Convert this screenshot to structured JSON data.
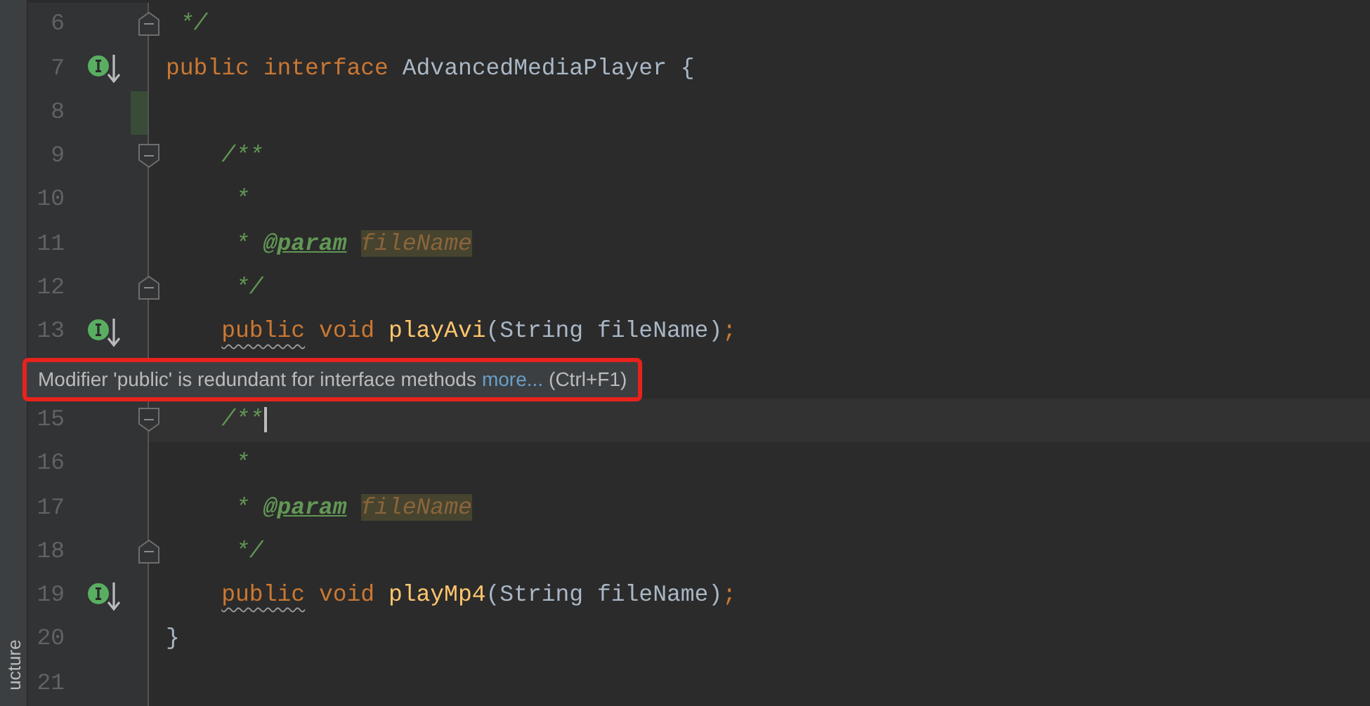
{
  "side_panel": {
    "tab": "ucture"
  },
  "lines_above": [
    {
      "number": "6",
      "implemented": false,
      "fold_start": false,
      "fold_end": true,
      "changed": false,
      "current": false,
      "tokens": [
        {
          "kind": "doc",
          "text": " */"
        }
      ]
    },
    {
      "number": "7",
      "implemented": true,
      "fold_start": false,
      "fold_end": false,
      "changed": false,
      "current": false,
      "tokens": [
        {
          "kind": "keyword",
          "text": "public",
          "warning": false
        },
        {
          "kind": "keyword",
          "text": " interface",
          "warning": false
        },
        {
          "kind": "plain",
          "text": " AdvancedMediaPlayer {"
        }
      ]
    },
    {
      "number": "8",
      "implemented": false,
      "fold_start": false,
      "fold_end": false,
      "changed": true,
      "current": false
    },
    {
      "number": "9",
      "implemented": false,
      "fold_start": true,
      "fold_end": false,
      "changed": false,
      "current": false,
      "tokens": [
        {
          "kind": "doc",
          "text": "    /**"
        }
      ]
    },
    {
      "number": "10",
      "implemented": false,
      "fold_start": false,
      "fold_end": false,
      "changed": false,
      "current": false,
      "tokens": [
        {
          "kind": "doc",
          "text": "     *"
        }
      ]
    },
    {
      "number": "11",
      "implemented": false,
      "fold_start": false,
      "fold_end": false,
      "changed": false,
      "current": false,
      "tokens": [
        {
          "kind": "doc",
          "text": "     *"
        },
        {
          "kind": "doctag",
          "text": " @param"
        },
        {
          "kind": "docparam",
          "text": " fileName"
        }
      ]
    },
    {
      "number": "12",
      "implemented": false,
      "fold_start": false,
      "fold_end": true,
      "changed": false,
      "current": false,
      "tokens": [
        {
          "kind": "doc",
          "text": "     */"
        }
      ]
    },
    {
      "number": "13",
      "implemented": true,
      "fold_start": false,
      "fold_end": false,
      "changed": false,
      "current": false,
      "tokens": [
        {
          "kind": "keyword",
          "text": "    public",
          "warning": true
        },
        {
          "kind": "keyword",
          "text": " void",
          "warning": false
        },
        {
          "kind": "method",
          "text": " playAvi"
        },
        {
          "kind": "plain",
          "text": "(String fileName)"
        },
        {
          "kind": "keyword",
          "text": ";",
          "warning": false
        }
      ]
    }
  ],
  "tooltip": {
    "message": "Modifier 'public' is redundant for interface methods",
    "link": "more...",
    "shortcut": "(Ctrl+F1)"
  },
  "lines_below": [
    {
      "number": "15",
      "implemented": false,
      "fold_start": true,
      "fold_end": false,
      "changed": false,
      "current": true,
      "tokens": [
        {
          "kind": "doc",
          "text": "    /**"
        }
      ]
    },
    {
      "number": "16",
      "implemented": false,
      "fold_start": false,
      "fold_end": false,
      "changed": false,
      "current": false,
      "tokens": [
        {
          "kind": "doc",
          "text": "     *"
        }
      ]
    },
    {
      "number": "17",
      "implemented": false,
      "fold_start": false,
      "fold_end": false,
      "changed": false,
      "current": false,
      "tokens": [
        {
          "kind": "doc",
          "text": "     *"
        },
        {
          "kind": "doctag",
          "text": " @param"
        },
        {
          "kind": "docparam",
          "text": " fileName"
        }
      ]
    },
    {
      "number": "18",
      "implemented": false,
      "fold_start": false,
      "fold_end": true,
      "changed": false,
      "current": false,
      "tokens": [
        {
          "kind": "doc",
          "text": "     */"
        }
      ]
    },
    {
      "number": "19",
      "implemented": true,
      "fold_start": false,
      "fold_end": false,
      "changed": false,
      "current": false,
      "tokens": [
        {
          "kind": "keyword",
          "text": "    public",
          "warning": true
        },
        {
          "kind": "keyword",
          "text": " void",
          "warning": false
        },
        {
          "kind": "method",
          "text": " playMp4"
        },
        {
          "kind": "plain",
          "text": "(String fileName)"
        },
        {
          "kind": "keyword",
          "text": ";",
          "warning": false
        }
      ]
    },
    {
      "number": "20",
      "implemented": false,
      "fold_start": false,
      "fold_end": false,
      "changed": false,
      "current": false,
      "tokens": [
        {
          "kind": "plain",
          "text": "}"
        }
      ]
    },
    {
      "number": "21",
      "implemented": false,
      "fold_start": false,
      "fold_end": false,
      "changed": false,
      "current": false
    }
  ]
}
